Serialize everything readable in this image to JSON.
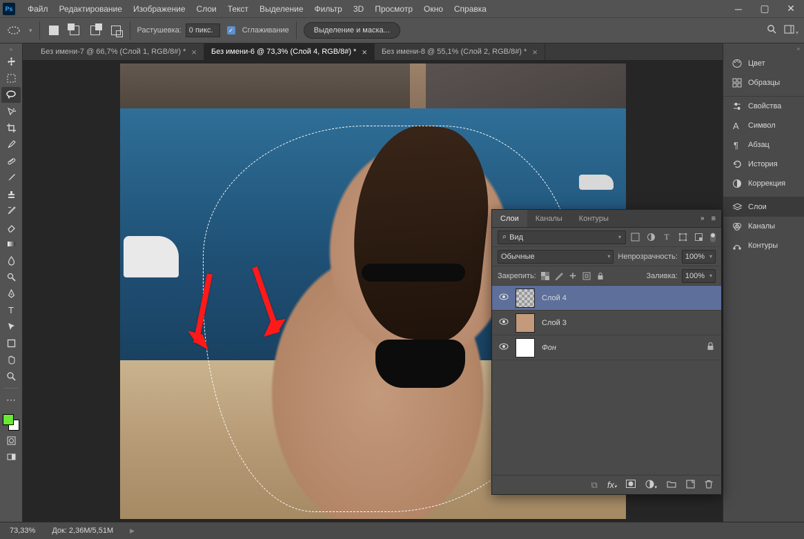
{
  "menubar": {
    "items": [
      "Файл",
      "Редактирование",
      "Изображение",
      "Слои",
      "Текст",
      "Выделение",
      "Фильтр",
      "3D",
      "Просмотр",
      "Окно",
      "Справка"
    ]
  },
  "options": {
    "feather_label": "Растушевка:",
    "feather_value": "0 пикс.",
    "antialias_label": "Сглаживание",
    "refine_button": "Выделение и маска..."
  },
  "tabs": [
    {
      "label": "Без имени-7 @ 66,7% (Слой 1, RGB/8#) *",
      "active": false
    },
    {
      "label": "Без имени-6 @ 73,3% (Слой 4, RGB/8#) *",
      "active": true
    },
    {
      "label": "Без имени-8 @ 55,1% (Слой 2, RGB/8#) *",
      "active": false
    }
  ],
  "foreground_color": "#6be833",
  "side_panels": {
    "group1": [
      {
        "icon": "palette",
        "label": "Цвет"
      },
      {
        "icon": "swatches",
        "label": "Образцы"
      }
    ],
    "group2": [
      {
        "icon": "sliders",
        "label": "Свойства"
      },
      {
        "icon": "char",
        "label": "Символ"
      },
      {
        "icon": "para",
        "label": "Абзац"
      },
      {
        "icon": "history",
        "label": "История"
      },
      {
        "icon": "adjust",
        "label": "Коррекция"
      }
    ],
    "group3": [
      {
        "icon": "layers",
        "label": "Слои",
        "selected": true
      },
      {
        "icon": "channels",
        "label": "Каналы"
      },
      {
        "icon": "paths",
        "label": "Контуры"
      }
    ]
  },
  "layers_panel": {
    "tabs": [
      "Слои",
      "Каналы",
      "Контуры"
    ],
    "search_label": "Вид",
    "blend_mode": "Обычные",
    "opacity_label": "Непрозрачность:",
    "opacity_value": "100%",
    "fill_label": "Заливка:",
    "fill_value": "100%",
    "lock_label": "Закрепить:",
    "items": [
      {
        "name": "Слой 4",
        "thumb": "checker",
        "selected": true,
        "locked": false
      },
      {
        "name": "Слой 3",
        "thumb": "photo",
        "selected": false,
        "locked": false
      },
      {
        "name": "Фон",
        "thumb": "white",
        "selected": false,
        "locked": true,
        "italic": true
      }
    ]
  },
  "status": {
    "zoom": "73,33%",
    "doc": "Док: 2,36M/5,51M"
  }
}
